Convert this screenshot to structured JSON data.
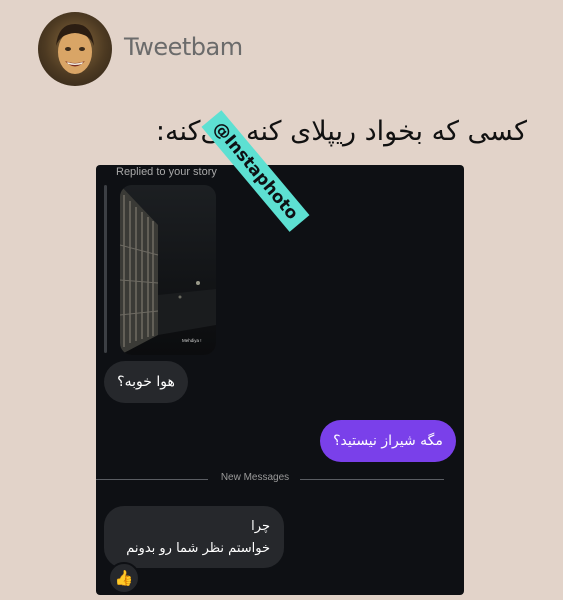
{
  "header": {
    "username": "Tweetbam",
    "caption": "کسی که بخواد ریپلای کنه می‌کنه:"
  },
  "chat": {
    "replied_label": "Replied to your story",
    "story_caption": "Mehdiya !",
    "messages": {
      "received_1": "هوا خوبه؟",
      "sent_1": "مگه شیراز نیستید؟",
      "received_2_line1": "چرا",
      "received_2_line2": "خواستم نظر شما رو بدونم"
    },
    "divider_label": "New Messages",
    "reaction_emoji": "👍"
  },
  "watermark": "@Instaphoto",
  "colors": {
    "page_bg": "#e2d3c9",
    "chat_bg": "#0e1014",
    "incoming_bubble": "#26282c",
    "outgoing_bubble": "#7a40ea",
    "watermark_bg": "#5de0d2"
  }
}
